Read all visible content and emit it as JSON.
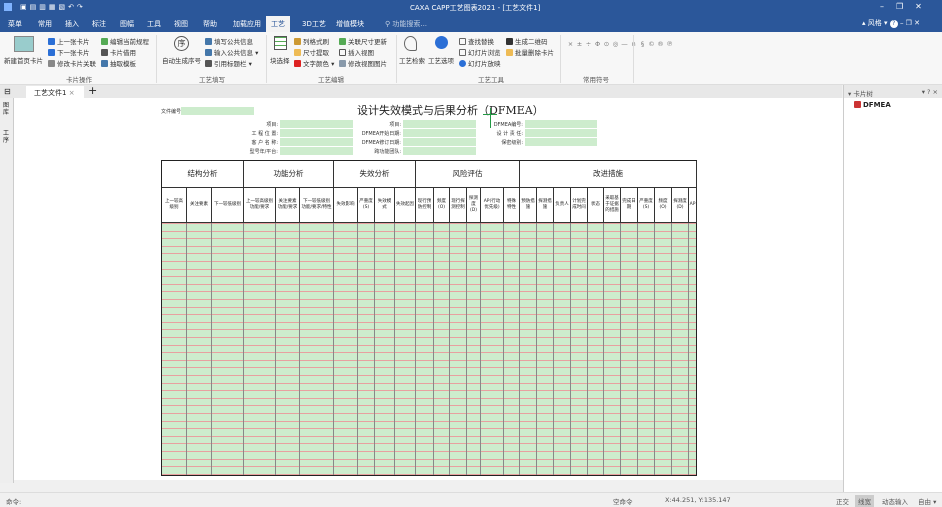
{
  "title": "CAXA CAPP工艺图表2021 - [工艺文件1]",
  "menu": [
    "菜单",
    "常用",
    "插入",
    "标注",
    "图幅",
    "工具",
    "视图",
    "帮助",
    "加载应用",
    "工艺",
    "3D工艺",
    "增值模块"
  ],
  "search_placeholder": "功能搜索...",
  "style_label": "风格",
  "ribbon": {
    "card_ops": {
      "big": "新建首页卡片",
      "items": [
        "上一张卡片",
        "下一张卡片",
        "修改卡片关联",
        "编辑当前规程",
        "卡片借用",
        "抽取模板"
      ],
      "label": "卡片操作"
    },
    "fill": {
      "big": "自动生成序号",
      "items": [
        "填写公共信息",
        "输入公共信息",
        "引用标题栏"
      ],
      "label": "工艺填写"
    },
    "edit": {
      "big": "块选择",
      "items": [
        "列格式刷",
        "尺寸提取",
        "文字颜色",
        "关联尺寸更新",
        "插入视图",
        "修改视图图片"
      ],
      "label": "工艺编辑"
    },
    "tools": {
      "big1": "工艺检索",
      "big2": "工艺选项",
      "items": [
        "查找替换",
        "幻灯片浏览",
        "幻灯片放映",
        "生成二维码",
        "批量删除卡片"
      ],
      "label": "工艺工具"
    },
    "symbols": {
      "items": [
        "×",
        "±",
        "÷",
        "Φ",
        "⊙",
        "◎",
        "—",
        "∩",
        "§",
        "©",
        "®",
        "℗"
      ],
      "label": "常用符号"
    }
  },
  "doc_tab": "工艺文件1",
  "left_tabs": [
    "图库",
    "工序"
  ],
  "right_panel": {
    "title": "卡片树",
    "item": "DFMEA"
  },
  "form": {
    "title": "设计失效模式与后果分析（DFMEA）",
    "file_no": "文件编号",
    "col1": [
      "项目:",
      "工 程 位 置:",
      "客 户 名 称:",
      "型号年/平台:"
    ],
    "col2": [
      "项目:",
      "DFMEA开始日期:",
      "DFMEA修订日期:",
      "跨功能团队:"
    ],
    "col3": [
      "DFMEA编号:",
      "设 计 责 任:",
      "保密级别:"
    ],
    "groups": [
      "结构分析",
      "功能分析",
      "失效分析",
      "风险评估",
      "改进措施"
    ],
    "columns": [
      "上一较高级别",
      "关注要素",
      "下一较低级别",
      "上一较高级别功能/要求",
      "关注要素功能/要求",
      "下一较低级别功能/要求/特性",
      "失效影响",
      "严重度(S)",
      "失效模式",
      "失效起因",
      "现行预防控制",
      "频度(O)",
      "现行探测控制",
      "探测度(D)",
      "AP(行动优先级)",
      "特殊特性",
      "预防措施",
      "探测措施",
      "负责人",
      "计划完成时间",
      "状态",
      "采取基于证据的措施",
      "完成日期",
      "严重度(S)",
      "频度(O)",
      "探测度(D)",
      "AP"
    ]
  },
  "status": {
    "prompt": "命令:",
    "cmd": "空命令",
    "coords": "X:44.251, Y:135.147",
    "modes": [
      "正交",
      "线宽",
      "动态输入",
      "自由"
    ]
  }
}
